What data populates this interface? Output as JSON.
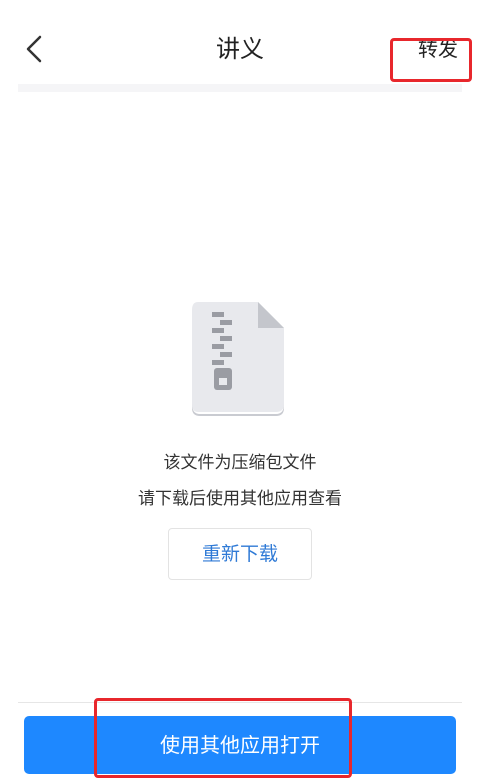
{
  "header": {
    "title": "讲义",
    "forward_label": "转发",
    "back_icon": "chevron-left-icon"
  },
  "content": {
    "file_icon": "zip-file-icon",
    "message_line1": "该文件为压缩包文件",
    "message_line2": "请下载后使用其他应用查看",
    "redownload_label": "重新下载"
  },
  "footer": {
    "open_with_label": "使用其他应用打开"
  },
  "colors": {
    "primary_blue": "#1e88ff",
    "link_blue": "#2f7ad6",
    "highlight_red": "#e8272c"
  }
}
